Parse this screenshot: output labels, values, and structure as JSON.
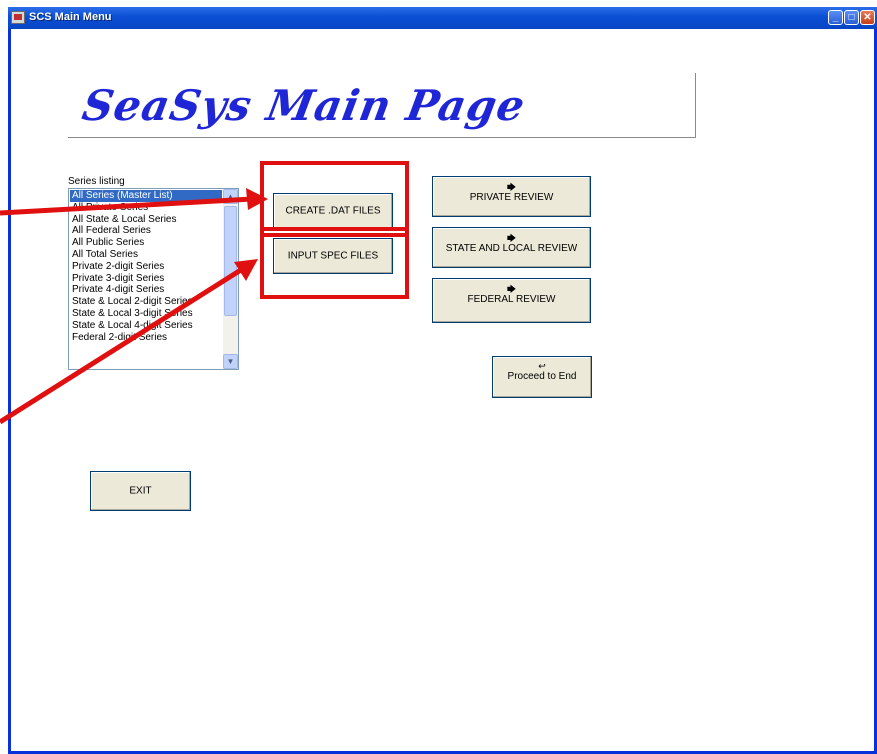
{
  "window": {
    "title": "SCS Main Menu",
    "min_label": "_",
    "max_label": "□",
    "close_label": "✕"
  },
  "banner": {
    "title": "SeaSys  Main  Page"
  },
  "series": {
    "label": "Series listing",
    "items": [
      "All Series (Master List)",
      "All Private Series",
      "All State & Local Series",
      "All Federal Series",
      "All Public Series",
      "All Total Series",
      "Private 2-digit Series",
      "Private 3-digit Series",
      "Private 4-digit Series",
      "State & Local 2-digit Series",
      "State & Local 3-digit Series",
      "State & Local 4-digit Series",
      "Federal 2-digit Series"
    ],
    "selected_index": 0,
    "scroll_up": "▲",
    "scroll_down": "▼"
  },
  "buttons": {
    "create_dat": "CREATE .DAT FILES",
    "input_spec": "INPUT SPEC FILES",
    "private_review": "PRIVATE REVIEW",
    "state_local_review": "STATE AND LOCAL REVIEW",
    "federal_review": "FEDERAL REVIEW",
    "proceed": "Proceed to End",
    "exit": "EXIT",
    "arrow_icon": "🡆",
    "proceed_icon": "↩"
  },
  "colors": {
    "annotation": "#e01010",
    "selection": "#316ac5",
    "banner_text": "#1f26d6"
  }
}
